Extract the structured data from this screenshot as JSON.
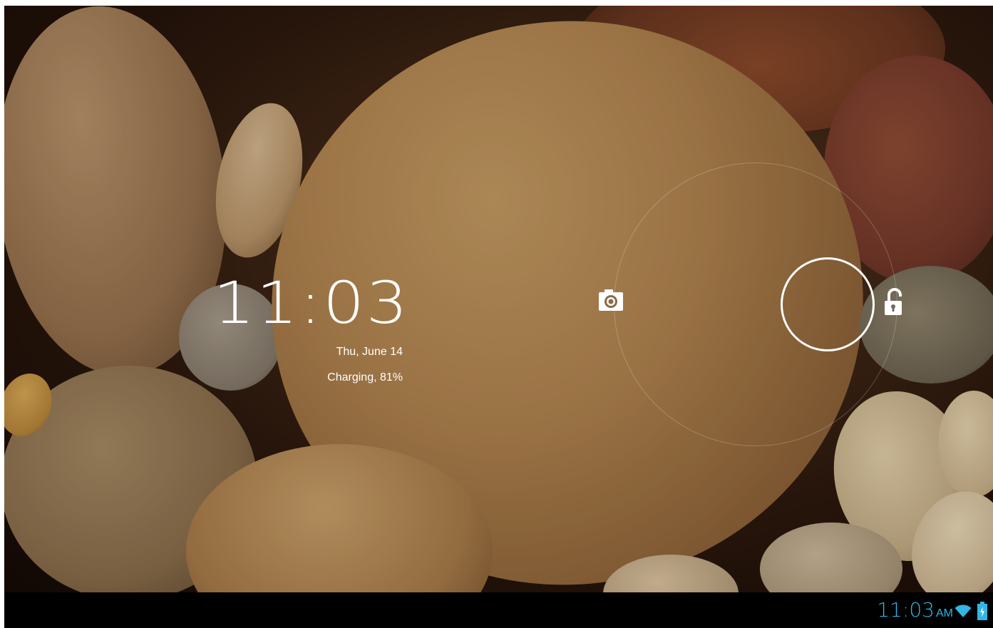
{
  "lockscreen": {
    "clock": "11:03",
    "date": "Thu, June 14",
    "charging_status": "Charging, 81%",
    "targets": {
      "camera_icon": "camera-icon",
      "unlock_icon": "unlock-icon"
    }
  },
  "status_bar": {
    "time": "11:03",
    "ampm": "AM",
    "wifi_icon": "wifi-icon",
    "battery_icon": "battery-charging-icon",
    "accent_color": "#33b5e5"
  }
}
